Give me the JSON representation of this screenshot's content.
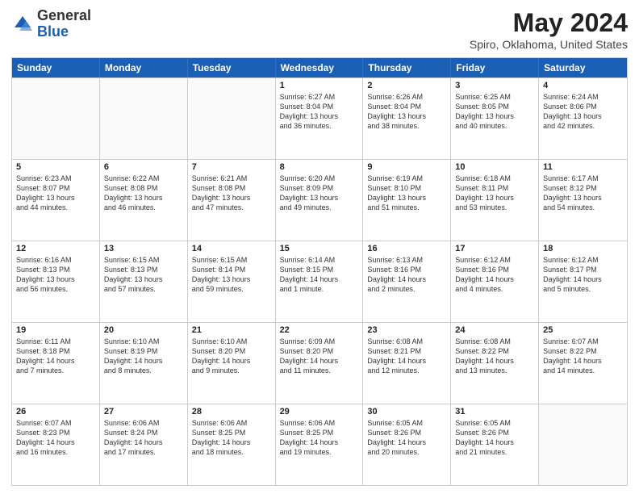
{
  "header": {
    "logo_general": "General",
    "logo_blue": "Blue",
    "main_title": "May 2024",
    "subtitle": "Spiro, Oklahoma, United States"
  },
  "days_of_week": [
    "Sunday",
    "Monday",
    "Tuesday",
    "Wednesday",
    "Thursday",
    "Friday",
    "Saturday"
  ],
  "weeks": [
    [
      {
        "day": "",
        "info": ""
      },
      {
        "day": "",
        "info": ""
      },
      {
        "day": "",
        "info": ""
      },
      {
        "day": "1",
        "info": "Sunrise: 6:27 AM\nSunset: 8:04 PM\nDaylight: 13 hours\nand 36 minutes."
      },
      {
        "day": "2",
        "info": "Sunrise: 6:26 AM\nSunset: 8:04 PM\nDaylight: 13 hours\nand 38 minutes."
      },
      {
        "day": "3",
        "info": "Sunrise: 6:25 AM\nSunset: 8:05 PM\nDaylight: 13 hours\nand 40 minutes."
      },
      {
        "day": "4",
        "info": "Sunrise: 6:24 AM\nSunset: 8:06 PM\nDaylight: 13 hours\nand 42 minutes."
      }
    ],
    [
      {
        "day": "5",
        "info": "Sunrise: 6:23 AM\nSunset: 8:07 PM\nDaylight: 13 hours\nand 44 minutes."
      },
      {
        "day": "6",
        "info": "Sunrise: 6:22 AM\nSunset: 8:08 PM\nDaylight: 13 hours\nand 46 minutes."
      },
      {
        "day": "7",
        "info": "Sunrise: 6:21 AM\nSunset: 8:08 PM\nDaylight: 13 hours\nand 47 minutes."
      },
      {
        "day": "8",
        "info": "Sunrise: 6:20 AM\nSunset: 8:09 PM\nDaylight: 13 hours\nand 49 minutes."
      },
      {
        "day": "9",
        "info": "Sunrise: 6:19 AM\nSunset: 8:10 PM\nDaylight: 13 hours\nand 51 minutes."
      },
      {
        "day": "10",
        "info": "Sunrise: 6:18 AM\nSunset: 8:11 PM\nDaylight: 13 hours\nand 53 minutes."
      },
      {
        "day": "11",
        "info": "Sunrise: 6:17 AM\nSunset: 8:12 PM\nDaylight: 13 hours\nand 54 minutes."
      }
    ],
    [
      {
        "day": "12",
        "info": "Sunrise: 6:16 AM\nSunset: 8:13 PM\nDaylight: 13 hours\nand 56 minutes."
      },
      {
        "day": "13",
        "info": "Sunrise: 6:15 AM\nSunset: 8:13 PM\nDaylight: 13 hours\nand 57 minutes."
      },
      {
        "day": "14",
        "info": "Sunrise: 6:15 AM\nSunset: 8:14 PM\nDaylight: 13 hours\nand 59 minutes."
      },
      {
        "day": "15",
        "info": "Sunrise: 6:14 AM\nSunset: 8:15 PM\nDaylight: 14 hours\nand 1 minute."
      },
      {
        "day": "16",
        "info": "Sunrise: 6:13 AM\nSunset: 8:16 PM\nDaylight: 14 hours\nand 2 minutes."
      },
      {
        "day": "17",
        "info": "Sunrise: 6:12 AM\nSunset: 8:16 PM\nDaylight: 14 hours\nand 4 minutes."
      },
      {
        "day": "18",
        "info": "Sunrise: 6:12 AM\nSunset: 8:17 PM\nDaylight: 14 hours\nand 5 minutes."
      }
    ],
    [
      {
        "day": "19",
        "info": "Sunrise: 6:11 AM\nSunset: 8:18 PM\nDaylight: 14 hours\nand 7 minutes."
      },
      {
        "day": "20",
        "info": "Sunrise: 6:10 AM\nSunset: 8:19 PM\nDaylight: 14 hours\nand 8 minutes."
      },
      {
        "day": "21",
        "info": "Sunrise: 6:10 AM\nSunset: 8:20 PM\nDaylight: 14 hours\nand 9 minutes."
      },
      {
        "day": "22",
        "info": "Sunrise: 6:09 AM\nSunset: 8:20 PM\nDaylight: 14 hours\nand 11 minutes."
      },
      {
        "day": "23",
        "info": "Sunrise: 6:08 AM\nSunset: 8:21 PM\nDaylight: 14 hours\nand 12 minutes."
      },
      {
        "day": "24",
        "info": "Sunrise: 6:08 AM\nSunset: 8:22 PM\nDaylight: 14 hours\nand 13 minutes."
      },
      {
        "day": "25",
        "info": "Sunrise: 6:07 AM\nSunset: 8:22 PM\nDaylight: 14 hours\nand 14 minutes."
      }
    ],
    [
      {
        "day": "26",
        "info": "Sunrise: 6:07 AM\nSunset: 8:23 PM\nDaylight: 14 hours\nand 16 minutes."
      },
      {
        "day": "27",
        "info": "Sunrise: 6:06 AM\nSunset: 8:24 PM\nDaylight: 14 hours\nand 17 minutes."
      },
      {
        "day": "28",
        "info": "Sunrise: 6:06 AM\nSunset: 8:25 PM\nDaylight: 14 hours\nand 18 minutes."
      },
      {
        "day": "29",
        "info": "Sunrise: 6:06 AM\nSunset: 8:25 PM\nDaylight: 14 hours\nand 19 minutes."
      },
      {
        "day": "30",
        "info": "Sunrise: 6:05 AM\nSunset: 8:26 PM\nDaylight: 14 hours\nand 20 minutes."
      },
      {
        "day": "31",
        "info": "Sunrise: 6:05 AM\nSunset: 8:26 PM\nDaylight: 14 hours\nand 21 minutes."
      },
      {
        "day": "",
        "info": ""
      }
    ]
  ]
}
